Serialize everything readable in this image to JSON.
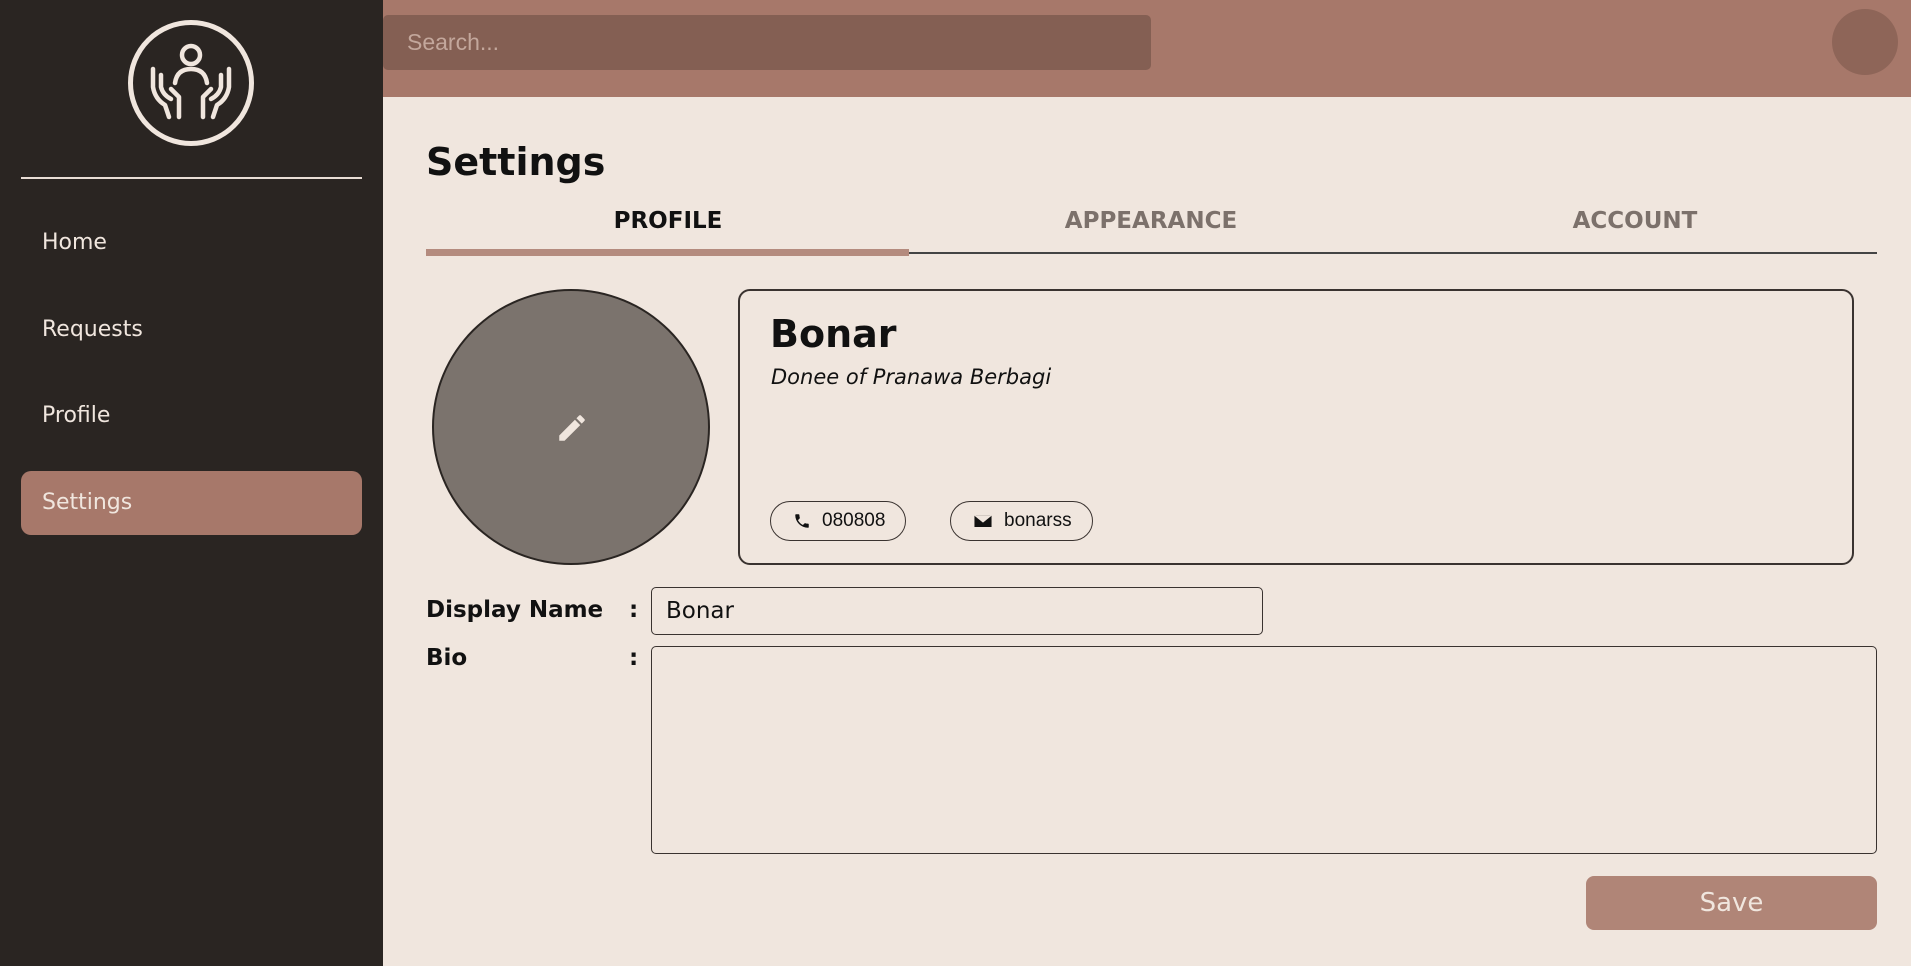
{
  "sidebar": {
    "logo_icon": "helping-hands-icon",
    "items": [
      {
        "label": "Home"
      },
      {
        "label": "Requests"
      },
      {
        "label": "Profile"
      },
      {
        "label": "Settings",
        "active": true
      }
    ]
  },
  "topbar": {
    "search_placeholder": "Search..."
  },
  "main": {
    "title": "Settings",
    "tabs": [
      {
        "label": "PROFILE",
        "active": true
      },
      {
        "label": "APPEARANCE"
      },
      {
        "label": "ACCOUNT"
      }
    ],
    "profile_card": {
      "name": "Bonar",
      "subtitle": "Donee of Pranawa Berbagi",
      "phone": "080808",
      "email": "bonarss"
    },
    "form": {
      "display_name_label": "Display Name",
      "bio_label": "Bio",
      "colon": ":",
      "display_name_value": "Bonar",
      "bio_value": "",
      "save_label": "Save"
    }
  },
  "colors": {
    "sidebar_bg": "#2a2522",
    "accent": "#a7786a",
    "page_bg": "#f0e6de"
  }
}
